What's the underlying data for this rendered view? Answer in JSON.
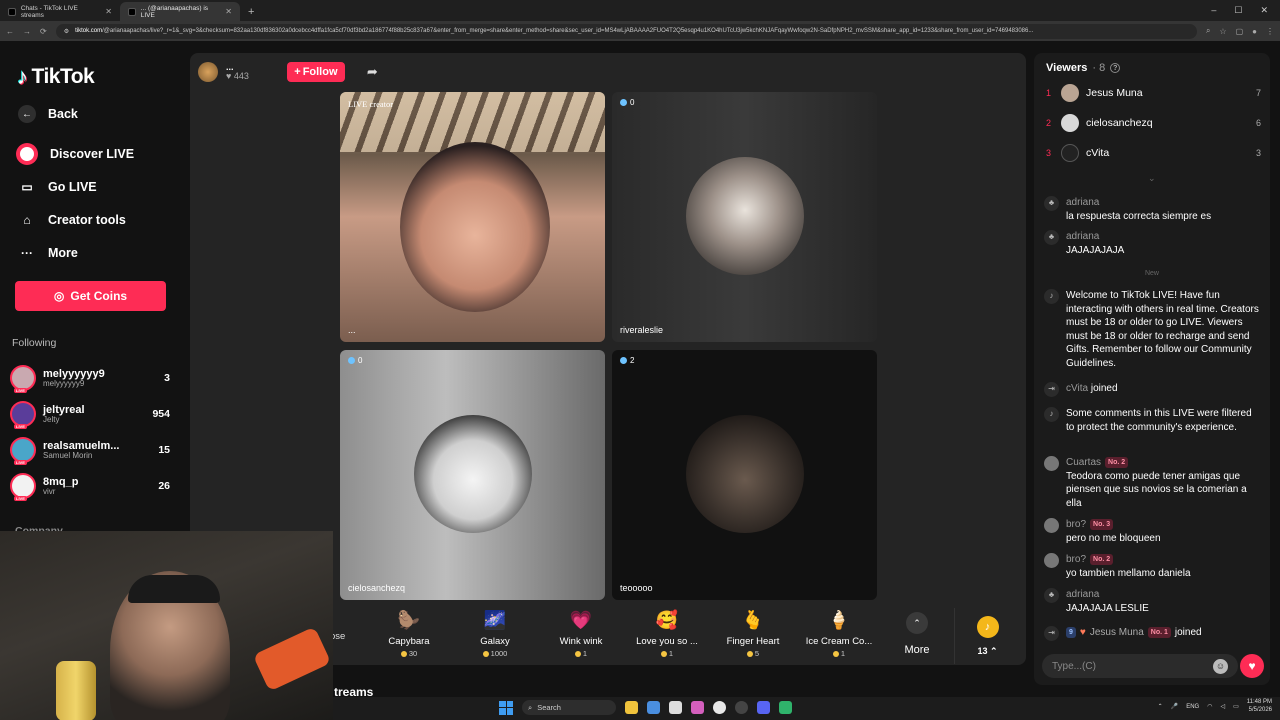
{
  "browser": {
    "tabs": [
      {
        "title": "Chats - TikTok LIVE streams",
        "active": false
      },
      {
        "title": "... (@arianaapachas) is LIVE",
        "active": true
      }
    ],
    "url_domain": "tiktok.com",
    "url_rest": "/@arianaapachas/live?_r=1&_svg=3&checksum=832aa130df836302a0dcebcc4dffa1fca5cf70df3bd2a186774f88b25c837a67&enter_from_merge=share&enter_method=share&sec_user_id=MS4wLjABAAAA2FUO4T2Q5esqp4u1KO4hUTcU3jw5kchKNJAFqayWwfoqw2N-SaDfpNPH2_mvSSM&share_app_id=1233&share_from_user_id=7469483086..."
  },
  "nav": {
    "logo": "TikTok",
    "back": "Back",
    "discover": "Discover LIVE",
    "go_live": "Go LIVE",
    "creator_tools": "Creator tools",
    "more": "More",
    "coins_button": "Get Coins",
    "following_title": "Following",
    "following": [
      {
        "name": "melyyyyyy9",
        "handle": "melyyyyyy9",
        "count": "3"
      },
      {
        "name": "jeltyreal",
        "handle": "Jelty",
        "count": "954"
      },
      {
        "name": "realsamuelm...",
        "handle": "Samuel Morin",
        "count": "15"
      },
      {
        "name": "8mq_p",
        "handle": "vivr",
        "count": "26"
      }
    ],
    "company": "Company",
    "live_tag": "LIVE"
  },
  "host": {
    "name": "...",
    "viewers": "443",
    "follow_label": "Follow"
  },
  "grid": {
    "cells": [
      {
        "top_label": "LIVE creator",
        "bottom_label": "..."
      },
      {
        "badge": "0",
        "bottom_label": "riveraleslie"
      },
      {
        "badge": "0",
        "bottom_label": "cielosanchezq"
      },
      {
        "badge": "2",
        "bottom_label": "teooooo"
      }
    ]
  },
  "gifts": {
    "partial": "ose",
    "items": [
      {
        "name": "Capybara",
        "price": "30",
        "icon": "capybara-icon",
        "glyph": "🦫"
      },
      {
        "name": "Galaxy",
        "price": "1000",
        "icon": "galaxy-icon",
        "glyph": "🌌"
      },
      {
        "name": "Wink wink",
        "price": "1",
        "icon": "wink-heart-icon",
        "glyph": "💗"
      },
      {
        "name": "Love you so ...",
        "price": "1",
        "icon": "love-face-icon",
        "glyph": "🥰"
      },
      {
        "name": "Finger Heart",
        "price": "5",
        "icon": "finger-heart-icon",
        "glyph": "🫰"
      },
      {
        "name": "Ice Cream Co...",
        "price": "1",
        "icon": "ice-cream-icon",
        "glyph": "🍦"
      }
    ],
    "more_label": "More",
    "coin_count": "13"
  },
  "streams_label": "treams",
  "chat": {
    "viewers_title": "Viewers",
    "viewers_count": "8",
    "top_viewers": [
      {
        "rank": "1",
        "name": "Jesus Muna",
        "score": "7"
      },
      {
        "rank": "2",
        "name": "cielosanchezq",
        "score": "6"
      },
      {
        "rank": "3",
        "name": "cVita",
        "score": "3"
      }
    ],
    "new_divider": "New",
    "messages_before": [
      {
        "user": "adriana",
        "text": "la respuesta correcta siempre es"
      },
      {
        "user": "adriana",
        "text": "JAJAJAJAJA"
      }
    ],
    "welcome": "Welcome to TikTok LIVE! Have fun interacting with others in real time. Creators must be 18 or older to go LIVE. Viewers must be 18 or older to recharge and send Gifts. Remember to follow our Community Guidelines.",
    "joined_1": {
      "user": "cVita",
      "text": "joined"
    },
    "filtered": "Some comments in this LIVE were filtered to protect the community's experience.",
    "messages_after": [
      {
        "user": "Cuartas",
        "tag": "No. 2",
        "text": "Teodora como puede tener amigas que piensen que sus novios se la comerian a ella"
      },
      {
        "user": "bro?",
        "tag": "No. 3",
        "text": "pero no me bloqueen"
      },
      {
        "user": "bro?",
        "tag": "No. 2",
        "text": "yo tambien mellamo daniela"
      },
      {
        "user": "adriana",
        "tag": "",
        "text": "JAJAJAJA LESLIE"
      }
    ],
    "joined_2": {
      "level": "9",
      "user": "Jesus Muna",
      "tag": "No. 1",
      "text": "joined"
    },
    "input_placeholder": "Type...(C)"
  },
  "taskbar": {
    "search": "Search",
    "lang": "ENG",
    "time": "11:48 PM",
    "date": "5/5/2026"
  },
  "colors": {
    "accent": "#fe2c55"
  }
}
